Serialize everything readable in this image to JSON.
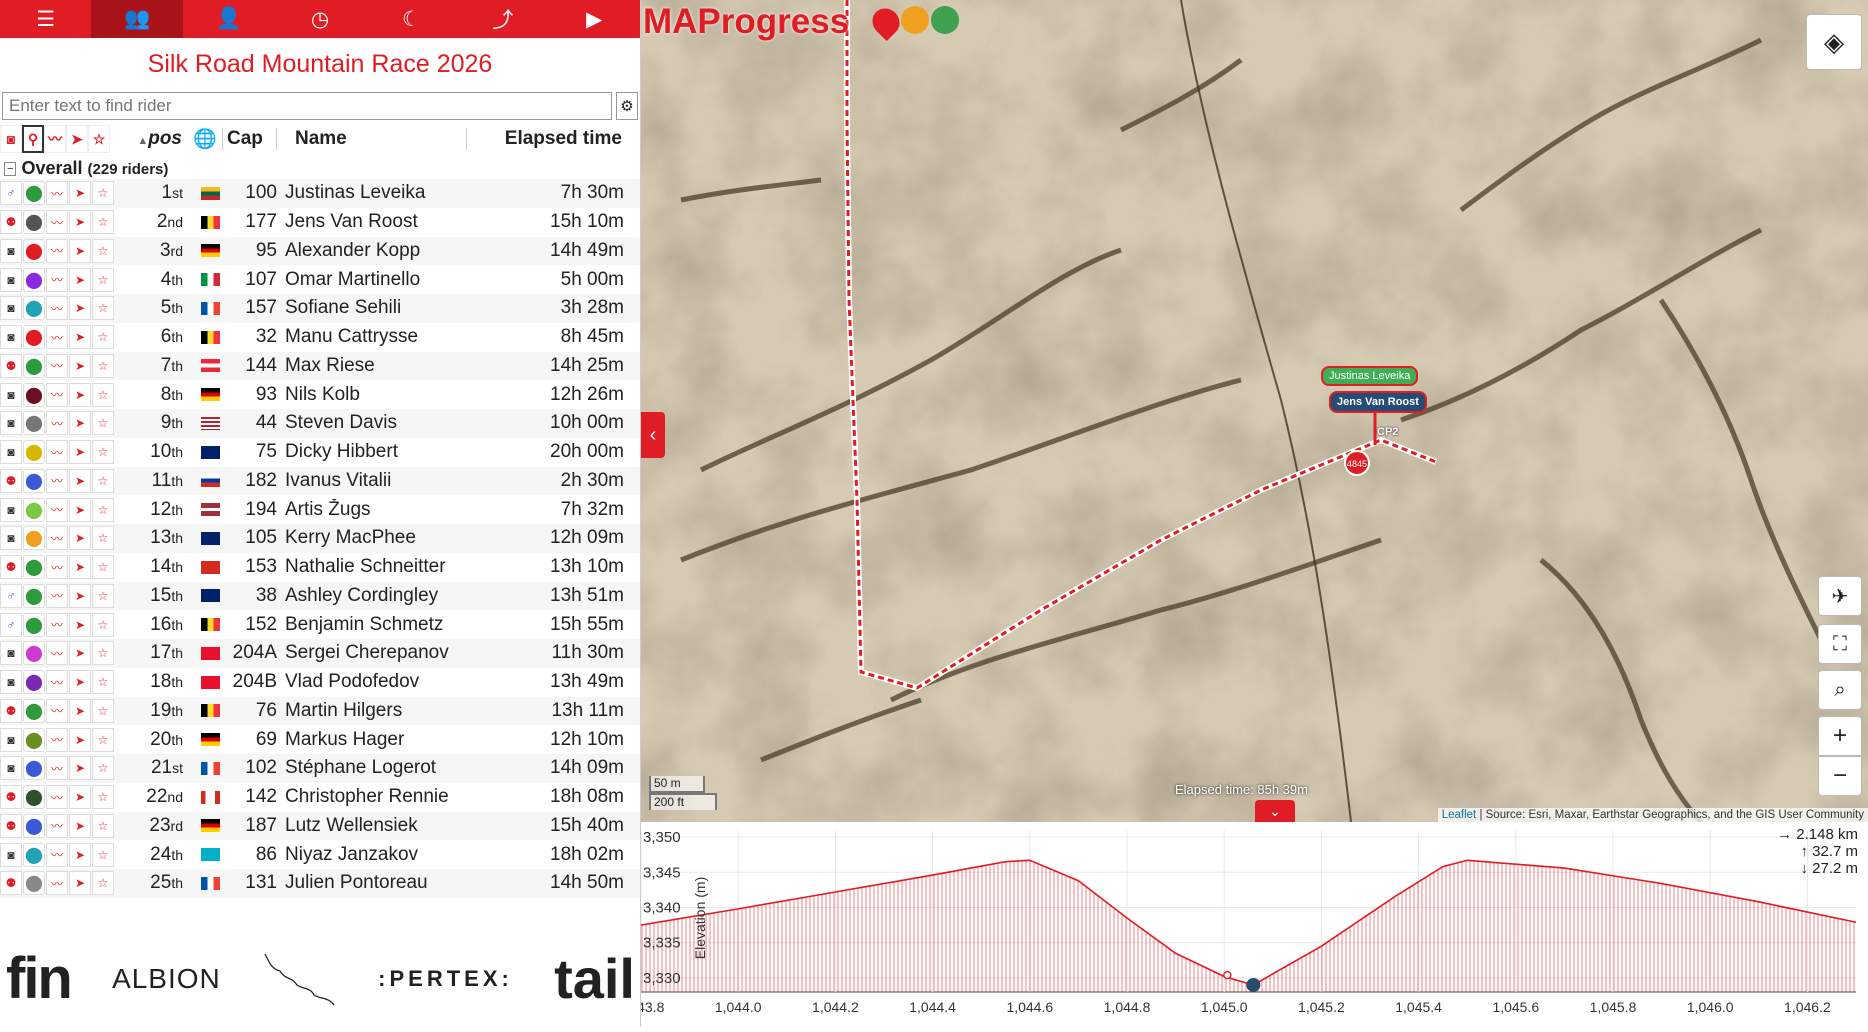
{
  "nav": {
    "tabs": [
      {
        "name": "menu-tab",
        "icon": "☰"
      },
      {
        "name": "riders-tab",
        "icon": "👥"
      },
      {
        "name": "rider-tab",
        "icon": "👤"
      },
      {
        "name": "clock-tab",
        "icon": "◷"
      },
      {
        "name": "night-tab",
        "icon": "☾"
      },
      {
        "name": "stats-tab",
        "icon": "⤴"
      },
      {
        "name": "play-tab",
        "icon": "▶"
      }
    ],
    "accent": "#e01c24"
  },
  "race": {
    "title": "Silk Road Mountain Race 2026"
  },
  "search": {
    "placeholder": "Enter text to find rider"
  },
  "columns": {
    "pos": "pos",
    "cap": "Cap",
    "name": "Name",
    "elapsed": "Elapsed time"
  },
  "group": {
    "label": "Overall",
    "count": "(229 riders)"
  },
  "riders": [
    {
      "num": "1",
      "suf": "st",
      "flag": "lt",
      "cap": "100",
      "name": "Justinas Leveika",
      "elapsed": "7h 30m",
      "icon": "♂",
      "pin": "#2e9a3e"
    },
    {
      "num": "2",
      "suf": "nd",
      "flag": "be",
      "cap": "177",
      "name": "Jens Van Roost",
      "elapsed": "15h 10m",
      "icon": "person",
      "pin": "#555"
    },
    {
      "num": "3",
      "suf": "rd",
      "flag": "de",
      "cap": "95",
      "name": "Alexander Kopp",
      "elapsed": "14h 49m",
      "icon": "cam",
      "pin": "#e01c24"
    },
    {
      "num": "4",
      "suf": "th",
      "flag": "it",
      "cap": "107",
      "name": "Omar Martinello",
      "elapsed": "5h 00m",
      "icon": "cam",
      "pin": "#8a2be2"
    },
    {
      "num": "5",
      "suf": "th",
      "flag": "fr",
      "cap": "157",
      "name": "Sofiane Sehili",
      "elapsed": "3h 28m",
      "icon": "cam",
      "pin": "#1fa3b5"
    },
    {
      "num": "6",
      "suf": "th",
      "flag": "be",
      "cap": "32",
      "name": "Manu Cattrysse",
      "elapsed": "8h 45m",
      "icon": "cam",
      "pin": "#e01c24"
    },
    {
      "num": "7",
      "suf": "th",
      "flag": "at",
      "cap": "144",
      "name": "Max Riese",
      "elapsed": "14h 25m",
      "icon": "person",
      "pin": "#2e9a3e"
    },
    {
      "num": "8",
      "suf": "th",
      "flag": "de",
      "cap": "93",
      "name": "Nils Kolb",
      "elapsed": "12h 26m",
      "icon": "cam",
      "pin": "#6b1020"
    },
    {
      "num": "9",
      "suf": "th",
      "flag": "us",
      "cap": "44",
      "name": "Steven Davis",
      "elapsed": "10h 00m",
      "icon": "cam",
      "pin": "#777"
    },
    {
      "num": "10",
      "suf": "th",
      "flag": "gb",
      "cap": "75",
      "name": "Dicky Hibbert",
      "elapsed": "20h 00m",
      "icon": "cam",
      "pin": "#d4b800"
    },
    {
      "num": "11",
      "suf": "th",
      "flag": "ru",
      "cap": "182",
      "name": "Ivanus Vitalii",
      "elapsed": "2h 30m",
      "icon": "person",
      "pin": "#3b5bd6"
    },
    {
      "num": "12",
      "suf": "th",
      "flag": "lv",
      "cap": "194",
      "name": "Artis Žugs",
      "elapsed": "7h 32m",
      "icon": "cam",
      "pin": "#7ac943"
    },
    {
      "num": "13",
      "suf": "th",
      "flag": "gb",
      "cap": "105",
      "name": "Kerry MacPhee",
      "elapsed": "12h 09m",
      "icon": "cam",
      "pin": "#f0a020"
    },
    {
      "num": "14",
      "suf": "th",
      "flag": "ch",
      "cap": "153",
      "name": "Nathalie Schneitter",
      "elapsed": "13h 10m",
      "icon": "person",
      "pin": "#2e9a3e"
    },
    {
      "num": "15",
      "suf": "th",
      "flag": "gb",
      "cap": "38",
      "name": "Ashley Cordingley",
      "elapsed": "13h 51m",
      "icon": "♂",
      "pin": "#2e9a3e"
    },
    {
      "num": "16",
      "suf": "th",
      "flag": "be",
      "cap": "152",
      "name": "Benjamin Schmetz",
      "elapsed": "15h 55m",
      "icon": "♂",
      "pin": "#2e9a3e"
    },
    {
      "num": "17",
      "suf": "th",
      "flag": "kg",
      "cap": "204A",
      "name": "Sergei Cherepanov",
      "elapsed": "11h 30m",
      "icon": "cam",
      "pin": "#d03ad0"
    },
    {
      "num": "18",
      "suf": "th",
      "flag": "kg",
      "cap": "204B",
      "name": "Vlad Podofedov",
      "elapsed": "13h 49m",
      "icon": "cam",
      "pin": "#7a2ab0"
    },
    {
      "num": "19",
      "suf": "th",
      "flag": "be",
      "cap": "76",
      "name": "Martin Hilgers",
      "elapsed": "13h 11m",
      "icon": "person",
      "pin": "#2e9a3e"
    },
    {
      "num": "20",
      "suf": "th",
      "flag": "de",
      "cap": "69",
      "name": "Markus Hager",
      "elapsed": "12h 10m",
      "icon": "cam",
      "pin": "#6b8e23"
    },
    {
      "num": "21",
      "suf": "st",
      "flag": "fr",
      "cap": "102",
      "name": "Stéphane Logerot",
      "elapsed": "14h 09m",
      "icon": "cam",
      "pin": "#3b5bd6"
    },
    {
      "num": "22",
      "suf": "nd",
      "flag": "ca",
      "cap": "142",
      "name": "Christopher Rennie",
      "elapsed": "18h 08m",
      "icon": "person",
      "pin": "#2f4f2f"
    },
    {
      "num": "23",
      "suf": "rd",
      "flag": "de",
      "cap": "187",
      "name": "Lutz Wellensiek",
      "elapsed": "15h 40m",
      "icon": "person",
      "pin": "#3b5bd6"
    },
    {
      "num": "24",
      "suf": "th",
      "flag": "kz",
      "cap": "86",
      "name": "Niyaz Janzakov",
      "elapsed": "18h 02m",
      "icon": "cam",
      "pin": "#1fa3b5"
    },
    {
      "num": "25",
      "suf": "th",
      "flag": "fr",
      "cap": "131",
      "name": "Julien Pontoreau",
      "elapsed": "14h 50m",
      "icon": "person",
      "pin": "#888"
    }
  ],
  "sponsors": {
    "s1": "fin",
    "s2": "ALBION",
    "s3": ":PERTEX:",
    "s4": "tail"
  },
  "map": {
    "logo": "MAProgress",
    "label_1": "Justinas Leveika",
    "label_2": "Jens Van Roost",
    "checkpoint": "CP2",
    "marker": "4845",
    "elapsed": "Elapsed time: 85h 39m",
    "scale_m": "50 m",
    "scale_ft": "200 ft",
    "attr_link": "Leaflet",
    "attribution": " | Source: Esri, Maxar, Earthstar Geographics, and the GIS User Community",
    "route_color": "#e01c24"
  },
  "elevation": {
    "y_label": "Elevation (m)",
    "distance": "→ 2.148 km",
    "ascent": "↑ 32.7 m",
    "descent": "↓ 27.2 m"
  },
  "chart_data": {
    "type": "area",
    "title": "",
    "xlabel": "",
    "ylabel": "Elevation (m)",
    "xlim": [
      1043.8,
      1046.3
    ],
    "ylim": [
      3328,
      3351
    ],
    "x_ticks": [
      "1,043.8",
      "1,044.0",
      "1,044.2",
      "1,044.4",
      "1,044.6",
      "1,044.8",
      "1,045.0",
      "1,045.2",
      "1,045.4",
      "1,045.6",
      "1,045.8",
      "1,046.0",
      "1,046.2"
    ],
    "y_ticks": [
      "3,330",
      "3,335",
      "3,340",
      "3,345",
      "3,350"
    ],
    "x": [
      1043.8,
      1044.0,
      1044.2,
      1044.4,
      1044.55,
      1044.6,
      1044.7,
      1044.8,
      1044.9,
      1045.0,
      1045.06,
      1045.2,
      1045.35,
      1045.45,
      1045.5,
      1045.7,
      1045.9,
      1046.1,
      1046.3
    ],
    "y": [
      3337.5,
      3339.8,
      3342.2,
      3344.6,
      3346.5,
      3346.7,
      3343.8,
      3338.5,
      3333.5,
      3330.2,
      3329.0,
      3334.5,
      3341.5,
      3345.8,
      3346.7,
      3345.6,
      3343.4,
      3340.8,
      3337.9
    ],
    "current_x": 1045.06
  }
}
